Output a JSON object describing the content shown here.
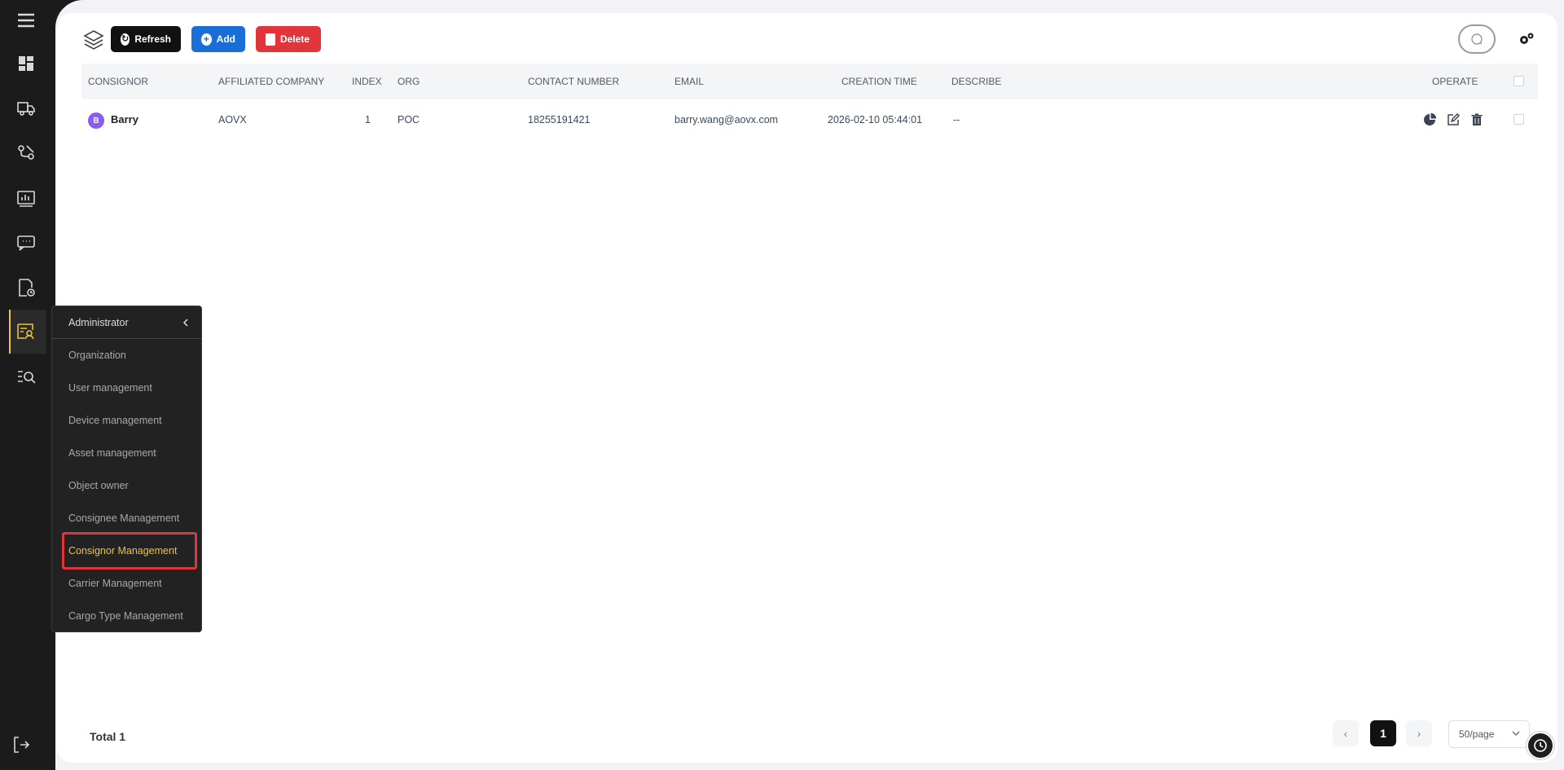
{
  "toolbar": {
    "refresh_label": "Refresh",
    "add_label": "Add",
    "delete_label": "Delete"
  },
  "table": {
    "columns": [
      "CONSIGNOR",
      "AFFILIATED COMPANY",
      "INDEX",
      "ORG",
      "CONTACT NUMBER",
      "EMAIL",
      "CREATION TIME",
      "DESCRIBE",
      "OPERATE"
    ],
    "rows": [
      {
        "avatar_letter": "B",
        "consignor": "Barry",
        "affiliated_company": "AOVX",
        "index": "1",
        "org": "POC",
        "contact_number": "18255191421",
        "email": "barry.wang@aovx.com",
        "creation_time": "2026-02-10 05:44:01",
        "describe": "--"
      }
    ]
  },
  "footer": {
    "total_label": "Total 1",
    "current_page": "1",
    "page_size": "50/page"
  },
  "menu": {
    "title": "Administrator",
    "items": [
      {
        "label": "Organization"
      },
      {
        "label": "User management"
      },
      {
        "label": "Device management"
      },
      {
        "label": "Asset management"
      },
      {
        "label": "Object owner"
      },
      {
        "label": "Consignee Management"
      },
      {
        "label": "Consignor Management",
        "selected": true
      },
      {
        "label": "Carrier Management"
      },
      {
        "label": "Cargo Type Management"
      }
    ]
  },
  "colors": {
    "accent": "#f0c23a",
    "highlight": "#e0353a",
    "add": "#1a6ed8",
    "avatar": "#8a5cf0"
  },
  "icons": {
    "rail": [
      "hamburger-icon",
      "dashboard-icon",
      "truck-icon",
      "route-icon",
      "report-icon",
      "message-icon",
      "document-clock-icon",
      "admin-icon",
      "search-list-icon",
      "logout-icon"
    ],
    "operate": [
      "pie-chart-icon",
      "edit-icon",
      "trash-icon"
    ]
  }
}
